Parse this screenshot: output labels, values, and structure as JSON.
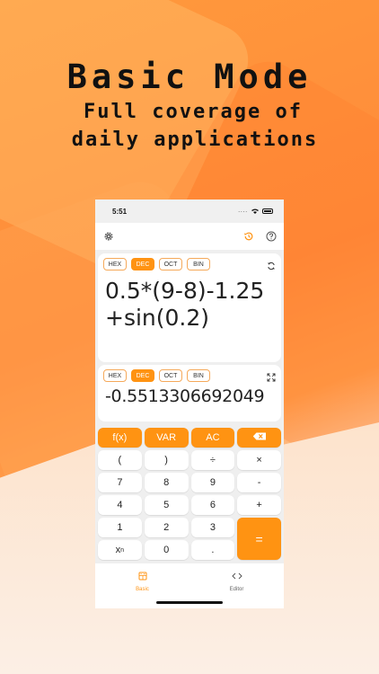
{
  "promo": {
    "headline": "Basic Mode",
    "subline1": "Full coverage of",
    "subline2": "daily applications"
  },
  "status": {
    "time": "5:51",
    "signal": "...."
  },
  "toolbar": {
    "settings_icon": "gear-icon",
    "history_icon": "history-icon",
    "help_icon": "help-icon"
  },
  "input_panel": {
    "bases": [
      "HEX",
      "DEC",
      "OCT",
      "BIN"
    ],
    "active_base": "DEC",
    "expression": "0.5*(9-8)-1.25+sin(0.2)",
    "convert_icon": "refresh-icon"
  },
  "result_panel": {
    "bases": [
      "HEX",
      "DEC",
      "OCT",
      "BIN"
    ],
    "active_base": "DEC",
    "result": "-0.5513306692049",
    "expand_icon": "expand-icon"
  },
  "keys": {
    "fx": "f(x)",
    "var": "VAR",
    "ac": "AC",
    "backspace_icon": "backspace-icon",
    "lparen": "(",
    "rparen": ")",
    "divide": "÷",
    "multiply": "×",
    "k7": "7",
    "k8": "8",
    "k9": "9",
    "minus": "-",
    "k4": "4",
    "k5": "5",
    "k6": "6",
    "plus": "+",
    "k1": "1",
    "k2": "2",
    "k3": "3",
    "equals": "=",
    "power_base": "x",
    "power_exp": "n",
    "k0": "0",
    "dot": "."
  },
  "tabs": [
    {
      "label": "Basic",
      "icon": "calculator-icon",
      "active": true
    },
    {
      "label": "Editor",
      "icon": "code-icon",
      "active": false
    }
  ],
  "colors": {
    "accent": "#ff9312"
  }
}
